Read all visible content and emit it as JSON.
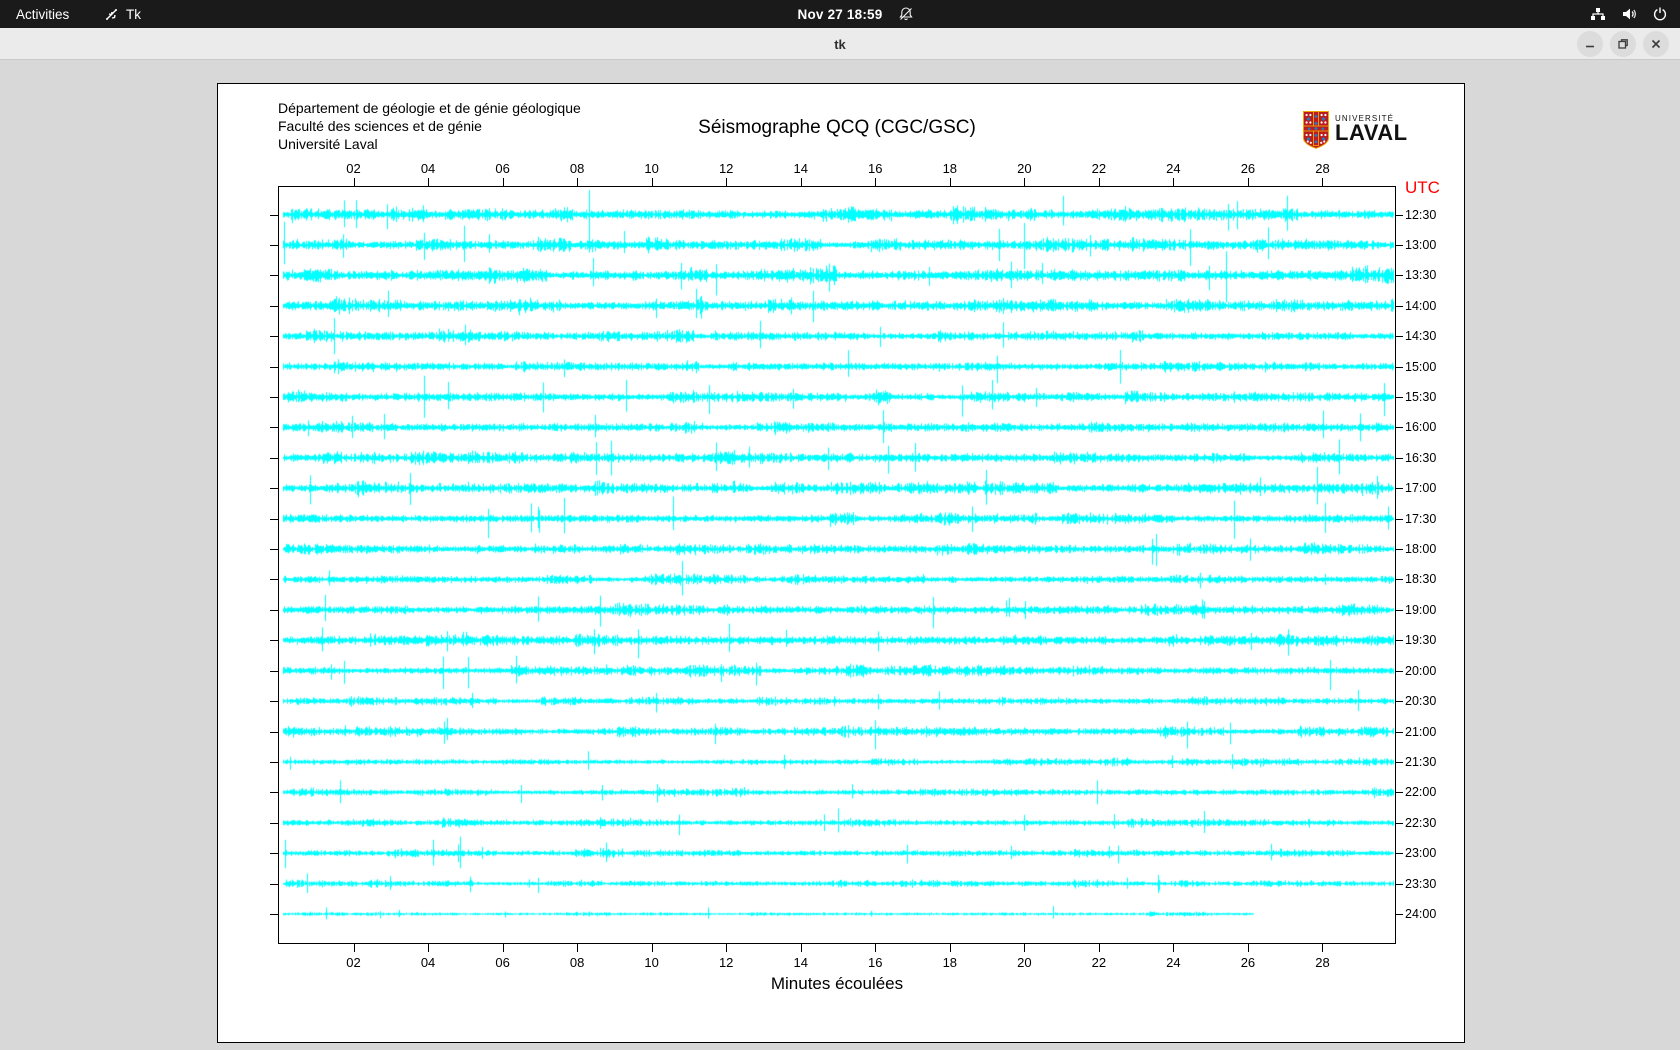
{
  "topbar": {
    "activities_label": "Activities",
    "app_name": "Tk",
    "clock": "Nov 27 18:59",
    "icons": [
      "tk-icon",
      "notifications-muted-icon",
      "network-wired-icon",
      "volume-icon",
      "power-icon"
    ]
  },
  "titlebar": {
    "title": "tk",
    "buttons": [
      "minimize",
      "maximize",
      "close"
    ]
  },
  "panel": {
    "header_lines": [
      "Département de géologie et de génie géologique",
      "Faculté des sciences et de génie",
      "Université Laval"
    ],
    "title": "Séismographe QCQ (CGC/GSC)",
    "logo": {
      "line1": "UNIVERSITÉ",
      "line2": "LAVAL",
      "shield_red": "#ba1c21",
      "shield_gold": "#f0a500",
      "shield_blue": "#1f7ec2"
    },
    "utc_label": "UTC",
    "xlabel": "Minutes écoulées",
    "colors": {
      "trace": "#00ffff",
      "utc_text": "#ff0000",
      "axis": "#000000"
    }
  },
  "chart_data": {
    "type": "seismogram",
    "title": "Séismographe QCQ (CGC/GSC)",
    "xlabel": "Minutes écoulées",
    "x_range_minutes": [
      0,
      30
    ],
    "x_ticks": [
      "02",
      "04",
      "06",
      "08",
      "10",
      "12",
      "14",
      "16",
      "18",
      "20",
      "22",
      "24",
      "26",
      "28"
    ],
    "right_axis_label": "UTC",
    "trace_color": "#00ffff",
    "seed": 20271859,
    "spike_probability": 0.006,
    "traces": [
      {
        "label": "12:30",
        "intensity": 0.95,
        "end": 1.0
      },
      {
        "label": "13:00",
        "intensity": 0.85,
        "end": 1.0
      },
      {
        "label": "13:30",
        "intensity": 1.0,
        "end": 1.0
      },
      {
        "label": "14:00",
        "intensity": 0.9,
        "end": 1.0
      },
      {
        "label": "14:30",
        "intensity": 0.75,
        "end": 1.0
      },
      {
        "label": "15:00",
        "intensity": 0.7,
        "end": 1.0
      },
      {
        "label": "15:30",
        "intensity": 0.8,
        "end": 1.0
      },
      {
        "label": "16:00",
        "intensity": 0.75,
        "end": 1.0
      },
      {
        "label": "16:30",
        "intensity": 0.75,
        "end": 1.0
      },
      {
        "label": "17:00",
        "intensity": 0.8,
        "end": 1.0
      },
      {
        "label": "17:30",
        "intensity": 0.75,
        "end": 1.0
      },
      {
        "label": "18:00",
        "intensity": 0.7,
        "end": 1.0
      },
      {
        "label": "18:30",
        "intensity": 0.65,
        "end": 1.0
      },
      {
        "label": "19:00",
        "intensity": 0.75,
        "end": 1.0
      },
      {
        "label": "19:30",
        "intensity": 0.8,
        "end": 1.0
      },
      {
        "label": "20:00",
        "intensity": 0.7,
        "end": 1.0
      },
      {
        "label": "20:30",
        "intensity": 0.55,
        "end": 1.0
      },
      {
        "label": "21:00",
        "intensity": 0.65,
        "end": 1.0
      },
      {
        "label": "21:30",
        "intensity": 0.5,
        "end": 1.0
      },
      {
        "label": "22:00",
        "intensity": 0.55,
        "end": 1.0
      },
      {
        "label": "22:30",
        "intensity": 0.55,
        "end": 1.0
      },
      {
        "label": "23:00",
        "intensity": 0.55,
        "end": 1.0
      },
      {
        "label": "23:30",
        "intensity": 0.45,
        "end": 1.0
      },
      {
        "label": "24:00",
        "intensity": 0.28,
        "end": 0.875
      }
    ]
  }
}
